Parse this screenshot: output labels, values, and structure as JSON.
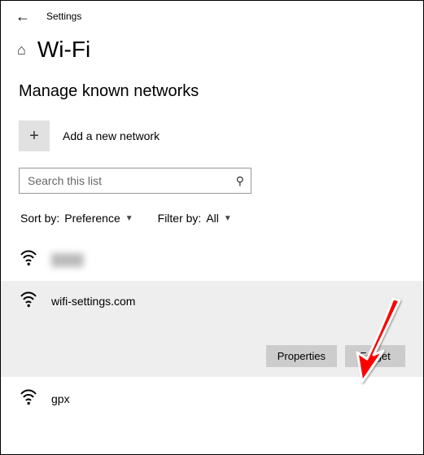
{
  "header": {
    "settings_label": "Settings"
  },
  "page": {
    "title": "Wi-Fi",
    "section_heading": "Manage known networks",
    "add_label": "Add a new network",
    "search_placeholder": "Search this list"
  },
  "filters": {
    "sort_label": "Sort by:",
    "sort_value": "Preference",
    "filter_label": "Filter by:",
    "filter_value": "All"
  },
  "networks": {
    "blurred": "████",
    "selected": "wifi-settings.com",
    "third": "gpx"
  },
  "buttons": {
    "properties": "Properties",
    "forget": "Forget"
  }
}
